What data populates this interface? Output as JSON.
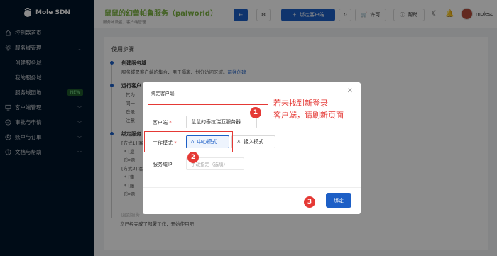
{
  "sidebar": {
    "brand": "Mole SDN",
    "items": [
      {
        "label": "控制器首页",
        "icon": "home-icon"
      },
      {
        "label": "服务域管理",
        "icon": "settings-icon",
        "expanded": true
      },
      {
        "label": "创建服务域"
      },
      {
        "label": "我的服务域"
      },
      {
        "label": "服务域园地",
        "badge": "NEW"
      },
      {
        "label": "客户端管理",
        "icon": "monitor-icon"
      },
      {
        "label": "审批与申请",
        "icon": "check-icon"
      },
      {
        "label": "账户与订单",
        "icon": "user-icon"
      },
      {
        "label": "文档与帮助",
        "icon": "help-icon"
      }
    ]
  },
  "header": {
    "title": "鼠鼠的幻兽帕鲁服务（palworld）",
    "subtitle": "服务域设置、客户端管理",
    "bind_client": "绑定客户端",
    "license": "许可",
    "help": "帮助",
    "username": "molesd"
  },
  "content": {
    "steps_title": "使用步骤",
    "step1_title": "创建服务域",
    "step1_text": "服务域是客户端的集合，用于隔离、划分访问区域。",
    "step1_link": "前往创建",
    "step2_title": "运行客户",
    "step2_lines": [
      "其为",
      "同一",
      "登录",
      "注意"
    ],
    "step3_title": "绑定服务",
    "step3_lines": [
      "[方式1] 客",
      "* [提",
      "[注意",
      "[方式2] 客",
      "* [审",
      "* [服",
      "[注意"
    ],
    "faded": "回到服务",
    "footer": "您已经完成了部署工作，开始使用吧"
  },
  "modal": {
    "title": "绑定客户端",
    "client_label": "客户端",
    "client_value": "鼠鼠的泰拉瑞亚服务器",
    "mode_label": "工作模式",
    "mode_center": "中心模式",
    "mode_access": "接入模式",
    "ip_label": "服务域IP",
    "ip_placeholder": "手动指定（选填）",
    "bind": "绑定"
  },
  "annotations": {
    "n1": "1",
    "n2": "2",
    "n3": "3",
    "note_line1": "若未找到新登录",
    "note_line2": "客户端，请刷新页面",
    "color": "#e53935"
  },
  "colors": {
    "primary": "#1d5fc6",
    "sidebar": "#001529",
    "title_green": "#7cb342"
  }
}
